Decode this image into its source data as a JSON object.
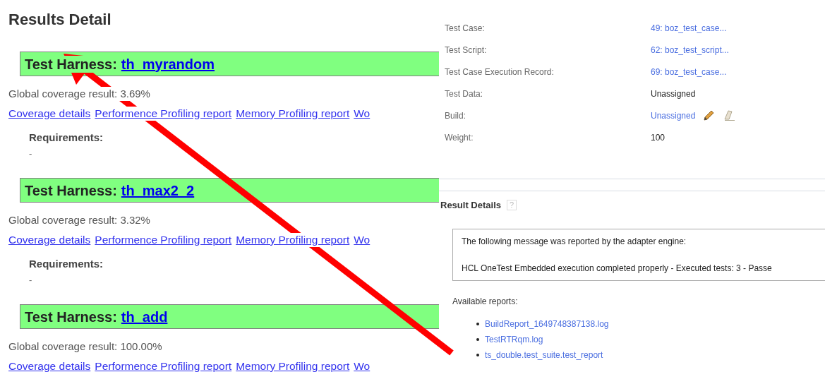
{
  "page": {
    "title": "Results Detail"
  },
  "harnesses": [
    {
      "label": "Test Harness:",
      "name": "th_myrandom",
      "coverage": "Global coverage result: 3.69%",
      "links": [
        "Coverage details",
        "Performence Profiling report",
        "Memory Profiling report",
        "Wo"
      ],
      "requirements_label": "Requirements:",
      "requirements": "-"
    },
    {
      "label": "Test Harness:",
      "name": "th_max2_2",
      "coverage": "Global coverage result: 3.32%",
      "links": [
        "Coverage details",
        "Performence Profiling report",
        "Memory Profiling report",
        "Wo"
      ],
      "requirements_label": "Requirements:",
      "requirements": "-"
    },
    {
      "label": "Test Harness:",
      "name": "th_add",
      "coverage": "Global coverage result: 100.00%",
      "links": [
        "Coverage details",
        "Performence Profiling report",
        "Memory Profiling report",
        "Wo"
      ]
    }
  ],
  "details": {
    "fields": [
      {
        "label": "Test Case:",
        "value": "49: boz_test_case...",
        "kind": "link"
      },
      {
        "label": "Test Script:",
        "value": "62: boz_test_script...",
        "kind": "link"
      },
      {
        "label": "Test Case Execution Record:",
        "value": "69: boz_test_case...",
        "kind": "link"
      },
      {
        "label": "Test Data:",
        "value": "Unassigned",
        "kind": "text"
      },
      {
        "label": "Build:",
        "value": "Unassigned",
        "kind": "link",
        "editable": true
      },
      {
        "label": "Weight:",
        "value": "100",
        "kind": "text"
      }
    ]
  },
  "result_details": {
    "title": "Result Details",
    "help": "?",
    "message": [
      "The following message was reported by the adapter engine:",
      "HCL OneTest Embedded execution completed properly - Executed tests: 3 - Passe"
    ],
    "reports_label": "Available reports:",
    "reports": [
      "BuildReport_1649748387138.log",
      "TestRTRqm.log",
      "ts_double.test_suite.test_report"
    ]
  }
}
